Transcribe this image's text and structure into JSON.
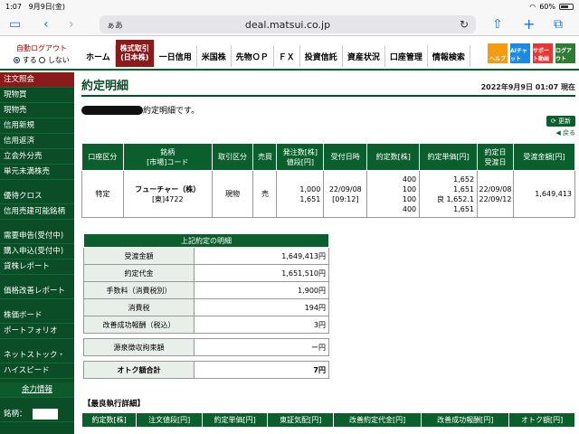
{
  "status": {
    "time": "1:07",
    "date": "9月9日(金)",
    "battery": "60%"
  },
  "browser": {
    "text_size": "ぁあ",
    "domain": "deal.matsui.co.jp"
  },
  "header": {
    "auto_logout": "自動ログアウト",
    "opt_on": "する",
    "opt_off": "しない",
    "nav": [
      "ホーム",
      "一日信用",
      "米国株",
      "先物ＯＰ",
      "ＦＸ",
      "投資信託",
      "資産状況",
      "口座管理",
      "情報検索"
    ],
    "active_line1": "株式取引",
    "active_line2": "(日本株)",
    "icons": [
      {
        "label": "ヘルプ",
        "color": "#f39c12"
      },
      {
        "label": "AIチャット",
        "color": "#1e88e5"
      },
      {
        "label": "サポート動画",
        "color": "#e53935"
      },
      {
        "label": "ログアウト",
        "color": "#2e7d32"
      }
    ]
  },
  "sidebar": {
    "items": [
      "注文照会",
      "現物買",
      "現物売",
      "信用新規",
      "信用返済",
      "立会外分売",
      "単元未満株売"
    ],
    "items2": [
      "優待クロス",
      "信用売建可能銘柄"
    ],
    "items3": [
      "需要申告(受付中)",
      "購入申込(受付中)",
      "貸株レポート"
    ],
    "items4": [
      "価格改善レポート"
    ],
    "items5": [
      "株価ボード",
      "ポートフォリオ"
    ],
    "items6": [
      "ネットストック・",
      "ハイスピード"
    ],
    "market_info": "余力情報",
    "stock_label": "銘柄："
  },
  "main": {
    "title": "約定明細",
    "timestamp": "2022年9月9日 01:07 現在",
    "notice": "約定明細です。",
    "refresh": "更新",
    "back": "戻る",
    "order_headers": [
      "口座区分",
      "銘柄\n[市場]コード",
      "取引区分",
      "売買",
      "発注数[株]\n値段[円]",
      "受付日時",
      "約定数[株]",
      "約定単価[円]",
      "約定日\n受渡日",
      "受渡金額[円]"
    ],
    "order_row": {
      "account": "特定",
      "name": "フューチャー（株）",
      "code": "[東]4722",
      "type": "現物",
      "side": "売",
      "qty": "1,000",
      "price": "1,651",
      "recv_date": "22/09/08",
      "recv_time": "[09:12]",
      "exec_qty": [
        "400",
        "100",
        "100",
        "400"
      ],
      "exec_price": [
        "1,652",
        "1,651",
        "良 1,652.1",
        "1,651"
      ],
      "exec_date": "22/09/08",
      "settle_date": "22/09/12",
      "amount": "1,649,413"
    },
    "summary_title": "上記約定の明細",
    "summary": [
      {
        "label": "受渡金額",
        "value": "1,649,413円"
      },
      {
        "label": "約定代金",
        "value": "1,651,510円"
      },
      {
        "label": "手数料（消費税別）",
        "value": "1,900円"
      },
      {
        "label": "消費税",
        "value": "194円"
      },
      {
        "label": "改善成功報酬（税込）",
        "value": "3円"
      }
    ],
    "withholding": {
      "label": "源泉徴収拘束額",
      "value": "ー円"
    },
    "total": {
      "label": "オトク額合計",
      "value": "7円"
    },
    "best_title": "【最良執行詳細】",
    "best_headers": [
      "約定数[株]",
      "注文値段[円]",
      "約定単価[円]",
      "東証気配[円]",
      "改善約定代金[円]",
      "改善成功報酬[円]",
      "オトク額[円]"
    ]
  }
}
